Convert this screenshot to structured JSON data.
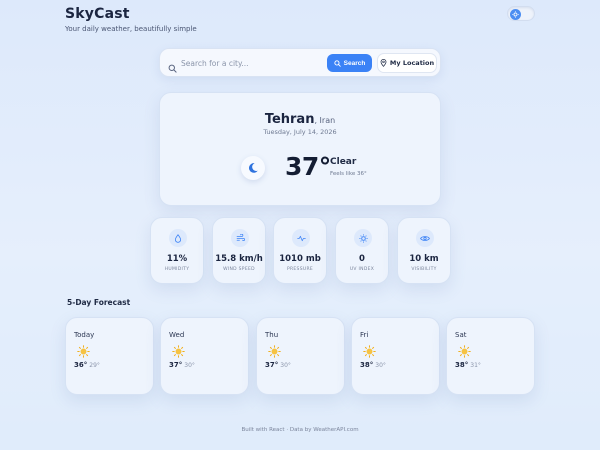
{
  "header": {
    "brand": "SkyCast",
    "tagline": "Your daily weather, beautifully simple"
  },
  "search": {
    "placeholder": "Search for a city...",
    "value": "",
    "search_label": "Search",
    "location_label": "My Location"
  },
  "current": {
    "city": "Tehran",
    "country": ", Iran",
    "date": "Tuesday, July 14, 2026",
    "temperature": "37°",
    "condition": "Clear",
    "feels_like": "Feels like 36°",
    "icon": "moon-icon"
  },
  "stats": [
    {
      "value": "11%",
      "label": "HUMIDITY",
      "icon": "droplet-icon"
    },
    {
      "value": "15.8 km/h",
      "label": "WIND SPEED",
      "icon": "wind-icon"
    },
    {
      "value": "1010 mb",
      "label": "PRESSURE",
      "icon": "pulse-icon"
    },
    {
      "value": "0",
      "label": "UV INDEX",
      "icon": "sun-outline-icon"
    },
    {
      "value": "10 km",
      "label": "VISIBILITY",
      "icon": "eye-icon"
    }
  ],
  "forecast": {
    "title": "5-Day Forecast",
    "days": [
      {
        "day": "Today",
        "high": "36°",
        "low": "29°",
        "icon": "sun-icon"
      },
      {
        "day": "Wed",
        "high": "37°",
        "low": "30°",
        "icon": "sun-icon"
      },
      {
        "day": "Thu",
        "high": "37°",
        "low": "30°",
        "icon": "sun-icon"
      },
      {
        "day": "Fri",
        "high": "38°",
        "low": "30°",
        "icon": "sun-icon"
      },
      {
        "day": "Sat",
        "high": "38°",
        "low": "31°",
        "icon": "sun-icon"
      }
    ]
  },
  "footer": {
    "text": "Built with React · Data by WeatherAPI.com"
  },
  "colors": {
    "accent": "#3b82f6",
    "background": "#e3edfc",
    "card": "#eef4fd",
    "text": "#1b2540"
  }
}
